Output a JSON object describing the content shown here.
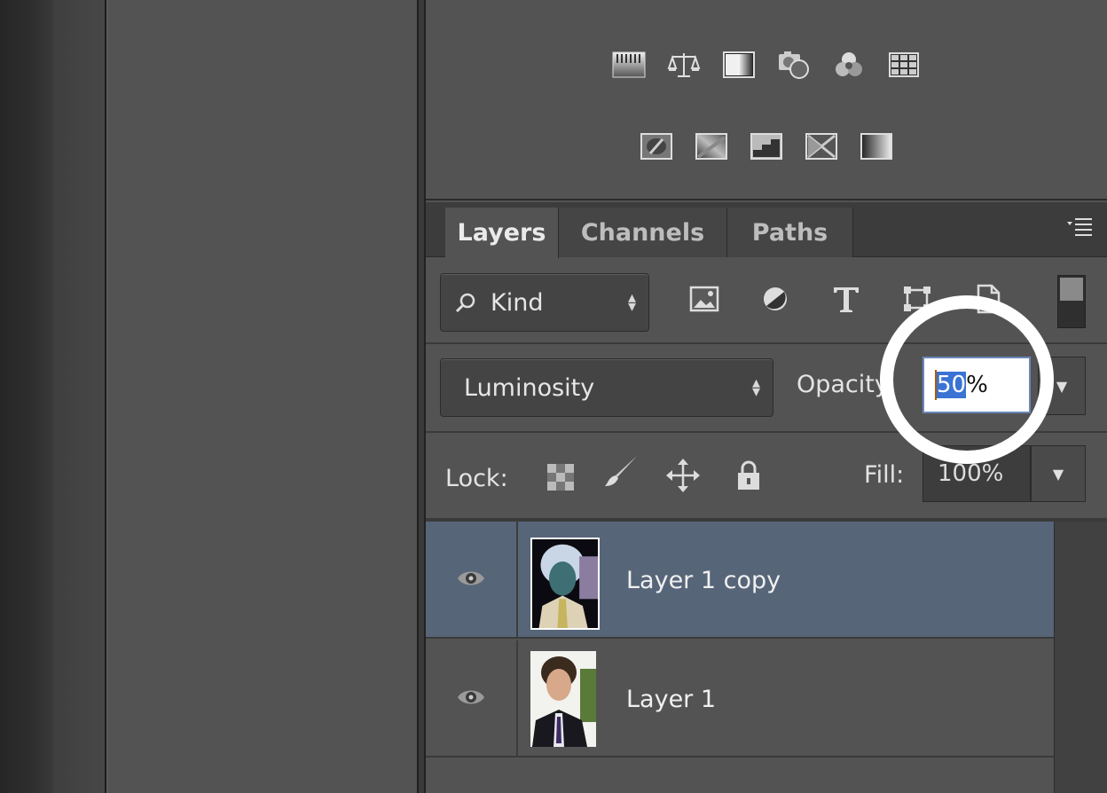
{
  "adjustments": {
    "row1": [
      "levels-icon",
      "color-balance-icon",
      "black-white-icon",
      "photo-filter-icon",
      "channel-mixer-icon",
      "color-lookup-icon"
    ],
    "row2": [
      "invert-icon",
      "posterize-icon",
      "threshold-icon",
      "selective-color-icon",
      "gradient-map-icon"
    ]
  },
  "layers_panel": {
    "tabs": [
      {
        "label": "Layers",
        "active": true
      },
      {
        "label": "Channels",
        "active": false
      },
      {
        "label": "Paths",
        "active": false
      }
    ],
    "filter": {
      "kind_label": "Kind"
    },
    "blend_mode": "Luminosity",
    "opacity_label": "Opacity:",
    "opacity_selected": "50",
    "opacity_rest": "%",
    "lock_label": "Lock:",
    "fill_label": "Fill:",
    "fill_value": "100%",
    "layers": [
      {
        "name": "Layer 1 copy",
        "visible": true,
        "selected": true
      },
      {
        "name": "Layer 1",
        "visible": true,
        "selected": false
      }
    ]
  },
  "colors": {
    "panel_bg": "#535353",
    "selected_layer": "#576579",
    "selection_highlight": "#3a73d4",
    "annotation_circle": "#ffffff"
  }
}
